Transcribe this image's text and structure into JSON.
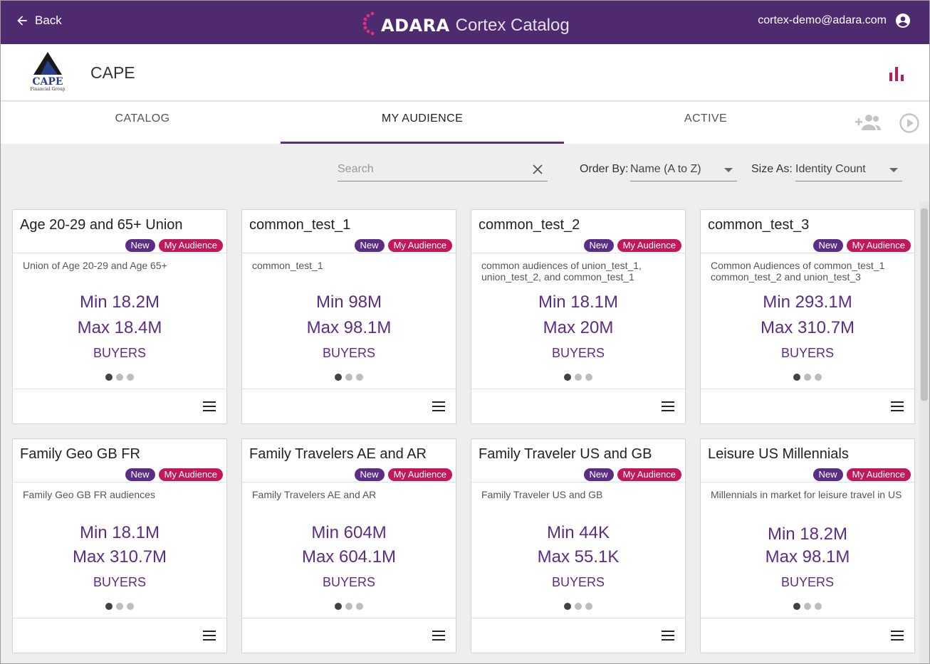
{
  "topbar": {
    "back_label": "Back",
    "brand": "ADARA",
    "product": "Cortex Catalog",
    "user_email": "cortex-demo@adara.com",
    "background": "#4e2a6e"
  },
  "company": {
    "name": "CAPE",
    "logo_text": "CAPE",
    "logo_subtext": "Financial Group"
  },
  "tabs": [
    {
      "label": "CATALOG",
      "active": false
    },
    {
      "label": "MY AUDIENCE",
      "active": true
    },
    {
      "label": "ACTIVE",
      "active": false
    }
  ],
  "filters": {
    "search_placeholder": "Search",
    "search_value": "",
    "order_label": "Order By:",
    "order_value": "Name (A to Z)",
    "size_label": "Size As:",
    "size_value": "Identity Count"
  },
  "colors": {
    "accent": "#5b2d84",
    "badge_my_audience": "#c2185b",
    "chart_icon": "#c2185b"
  },
  "cards": [
    {
      "title": "Age 20-29 and 65+ Union",
      "badge_new": "New",
      "badge_my": "My Audience",
      "description": "Union of Age 20-29 and Age 65+",
      "min": "Min 18.2M",
      "max": "Max 18.4M",
      "metric": "BUYERS",
      "page": 1,
      "pages": 3
    },
    {
      "title": "common_test_1",
      "badge_new": "New",
      "badge_my": "My Audience",
      "description": "common_test_1",
      "min": "Min 98M",
      "max": "Max 98.1M",
      "metric": "BUYERS",
      "page": 1,
      "pages": 3
    },
    {
      "title": "common_test_2",
      "badge_new": "New",
      "badge_my": "My Audience",
      "description": "common audiences of union_test_1, union_test_2, and common_test_1",
      "min": "Min 18.1M",
      "max": "Max 20M",
      "metric": "BUYERS",
      "page": 1,
      "pages": 3
    },
    {
      "title": "common_test_3",
      "badge_new": "New",
      "badge_my": "My Audience",
      "description": "Common Audiences of common_test_1 common_test_2 and union_test_3",
      "min": "Min 293.1M",
      "max": "Max 310.7M",
      "metric": "BUYERS",
      "page": 1,
      "pages": 3
    },
    {
      "title": "Family Geo GB FR",
      "badge_new": "New",
      "badge_my": "My Audience",
      "description": "Family Geo GB FR audiences",
      "min": "Min 18.1M",
      "max": "Max 310.7M",
      "metric": "BUYERS",
      "page": 1,
      "pages": 3
    },
    {
      "title": "Family Travelers AE and AR",
      "badge_new": "New",
      "badge_my": "My Audience",
      "description": "Family Travelers AE and AR",
      "min": "Min 604M",
      "max": "Max 604.1M",
      "metric": "BUYERS",
      "page": 1,
      "pages": 3
    },
    {
      "title": "Family Traveler US and GB",
      "badge_new": "New",
      "badge_my": "My Audience",
      "description": "Family Traveler US and GB",
      "min": "Min 44K",
      "max": "Max 55.1K",
      "metric": "BUYERS",
      "page": 1,
      "pages": 3
    },
    {
      "title": "Leisure US Millennials",
      "badge_new": "New",
      "badge_my": "My Audience",
      "description": "Millennials in market for leisure travel in US",
      "min": "Min 18.2M",
      "max": "Max 98.1M",
      "metric": "BUYERS",
      "page": 1,
      "pages": 3
    }
  ]
}
